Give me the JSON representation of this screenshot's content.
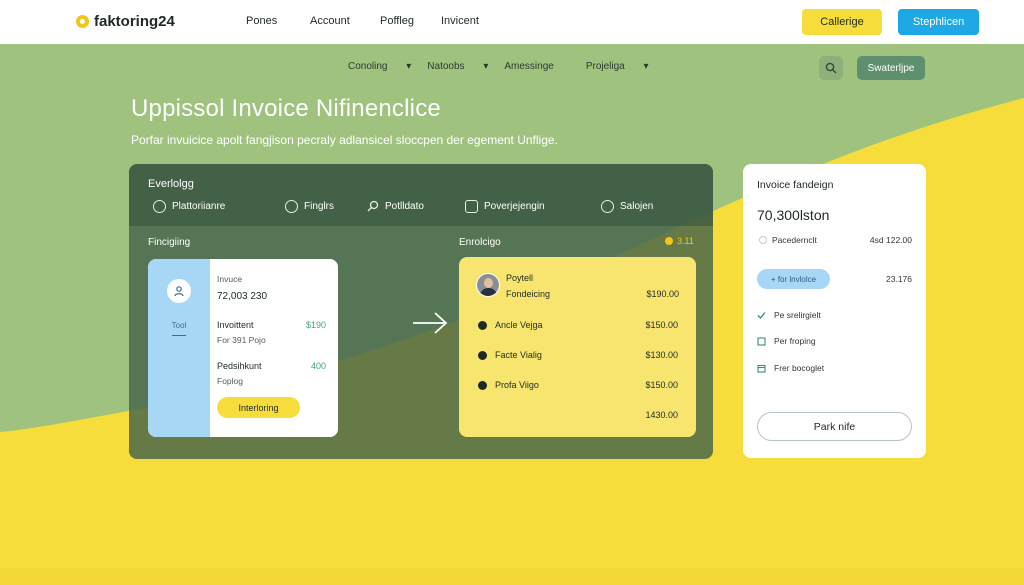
{
  "brand": {
    "name": "faktoring24"
  },
  "topnav": {
    "items": [
      "Pones",
      "Account",
      "Poffleg",
      "Invicent"
    ]
  },
  "top_buttons": {
    "primary": "Callerige",
    "secondary": "Stephlicen"
  },
  "subnav": {
    "items": [
      "Conoling",
      "Natoobs",
      "Amessinge",
      "Projeliga"
    ],
    "action_button": "Swaterljpe"
  },
  "hero": {
    "title": "Uppissol Invoice Nifinenclice",
    "subtitle": "Porfar invuicice apolt fangjison pecraly adlansicel sloccpen der egement Unflige."
  },
  "panel": {
    "title": "Everlolgg",
    "tabs": [
      "Plattoriianre",
      "Finglrs",
      "Potlldato",
      "Poverjejengin",
      "Salojen"
    ],
    "left_section": "Fincigiing",
    "right_section": "Enrolcigo",
    "badge": "3.11",
    "invoice_card": {
      "side_label": "Tool",
      "label": "Invuce",
      "number": "72,003 230",
      "row1_label": "Invoittent",
      "row1_sub": "For 391 Pojo",
      "row1_amount": "$190",
      "row2_label": "Pedsihkunt",
      "row2_sub": "Foplog",
      "row2_amount": "400",
      "button": "Interloring"
    },
    "yellow_card": {
      "rows": [
        {
          "label": "Poytell",
          "sub": "Fondeicing",
          "amount": "$190.00"
        },
        {
          "label": "Ancle Vejga",
          "amount": "$150.00"
        },
        {
          "label": "Facte Vialig",
          "amount": "$130.00"
        },
        {
          "label": "Profa Viigo",
          "amount": "$150.00"
        }
      ],
      "total": "1430.00"
    }
  },
  "right_card": {
    "title": "Invoice fandeign",
    "amount": "70,300lston",
    "row1_label": "Pacedernclt",
    "row1_value": "4sd 122.00",
    "pill": "+ for lnvlolce",
    "pill_value": "23.176",
    "checks": [
      "Pe srelirgielt",
      "Per froping",
      "Frer bocoglet"
    ],
    "button": "Park nife"
  }
}
